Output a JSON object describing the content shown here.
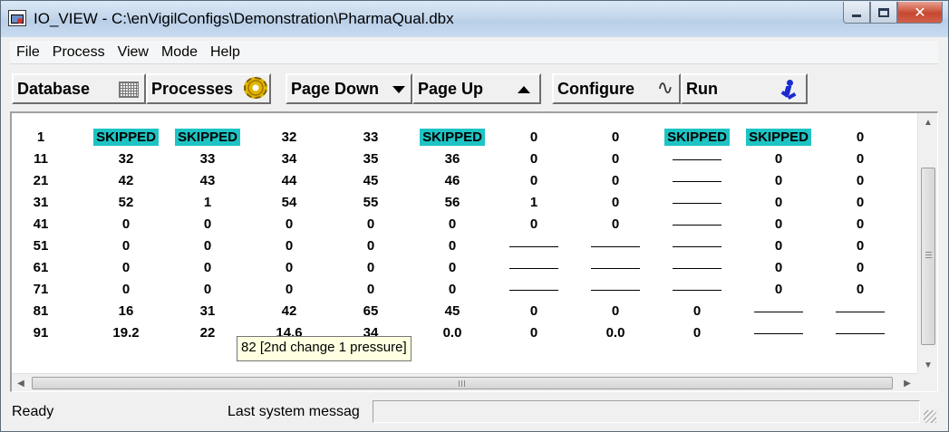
{
  "window": {
    "title": "IO_VIEW - C:\\enVigilConfigs\\Demonstration\\PharmaQual.dbx",
    "minimize_glyph": "",
    "close_glyph": "✕"
  },
  "menu": [
    "File",
    "Process",
    "View",
    "Mode",
    "Help"
  ],
  "toolbar": {
    "database": "Database",
    "processes": "Processes",
    "page_down": "Page Down",
    "page_up": "Page Up",
    "configure": "Configure",
    "configure_glyph": "∿",
    "run": "Run"
  },
  "grid": {
    "rows": [
      [
        "1",
        "SKIPPED",
        "SKIPPED",
        "32",
        "33",
        "SKIPPED",
        "0",
        "0",
        "SKIPPED",
        "SKIPPED",
        "0"
      ],
      [
        "11",
        "32",
        "33",
        "34",
        "35",
        "36",
        "0",
        "0",
        "—",
        "0",
        "0"
      ],
      [
        "21",
        "42",
        "43",
        "44",
        "45",
        "46",
        "0",
        "0",
        "—",
        "0",
        "0"
      ],
      [
        "31",
        "52",
        "1",
        "54",
        "55",
        "56",
        "1",
        "0",
        "—",
        "0",
        "0"
      ],
      [
        "41",
        "0",
        "0",
        "0",
        "0",
        "0",
        "0",
        "0",
        "—",
        "0",
        "0"
      ],
      [
        "51",
        "0",
        "0",
        "0",
        "0",
        "0",
        "—",
        "—",
        "—",
        "0",
        "0"
      ],
      [
        "61",
        "0",
        "0",
        "0",
        "0",
        "0",
        "—",
        "—",
        "—",
        "0",
        "0"
      ],
      [
        "71",
        "0",
        "0",
        "0",
        "0",
        "0",
        "—",
        "—",
        "—",
        "0",
        "0"
      ],
      [
        "81",
        "16",
        "31",
        "42",
        "65",
        "45",
        "0",
        "0",
        "0",
        "—",
        "—"
      ],
      [
        "91",
        "19.2",
        "22",
        "14.6",
        "34",
        "0.0",
        "0",
        "0.0",
        "0",
        "—",
        "—"
      ]
    ]
  },
  "tooltip": "82 [2nd change 1 pressure]",
  "status": {
    "ready": "Ready",
    "message_label": "Last system messag"
  },
  "colors": {
    "skipped_highlight": "#1ec4c4",
    "run_icon": "#1b2bd1"
  },
  "icons": {
    "app": "io-view-app-icon",
    "database": "grid-icon",
    "processes": "gear-icon",
    "page_down": "caret-down-icon",
    "page_up": "caret-up-icon",
    "configure": "wrench-wave-icon",
    "run": "running-man-icon"
  }
}
